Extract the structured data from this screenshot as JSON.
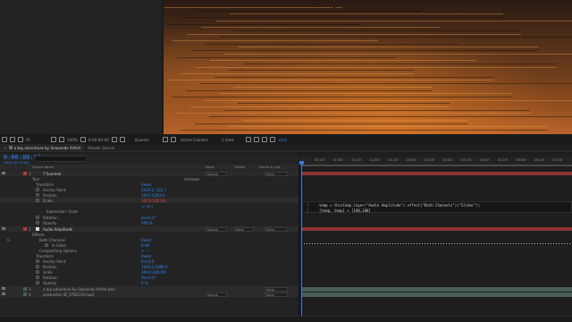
{
  "viewer_toolbar": {
    "snapping_label": "Fit",
    "zoom": "100%",
    "timecode": "0:00:00:00",
    "resolution": "Quarter",
    "camera": "Active Camera",
    "views": "1 View",
    "plus_value": "+0,0"
  },
  "tabs": [
    {
      "label": "a big adventure by Seasonds Artlist"
    },
    {
      "label": "Render Queue"
    }
  ],
  "timeline": {
    "timecode": "0:00:00:00",
    "fps": "00000 (29.97 fps)",
    "header": {
      "source_name": "Source Name",
      "mode": "Mode",
      "trkmat": "TrkMat",
      "parent": "Parent & Link"
    },
    "animate_label": "Animate:",
    "ruler_ticks": [
      "00:15f",
      "01:00f",
      "01:15f",
      "02:00f",
      "02:15f",
      "03:00f",
      "03:15f",
      "04:00f",
      "04:15f",
      "05:00f",
      "05:15f",
      "06:00f",
      "06:15f",
      "07:00f"
    ],
    "rows": [
      {
        "num": "1",
        "name": "T  Summer",
        "mode": "Normal",
        "parent": "None"
      },
      {
        "name": "Text"
      },
      {
        "name": "Transform",
        "value": "Reset"
      },
      {
        "name": "Anchor Point",
        "value": "1319.2,-122.7"
      },
      {
        "name": "Position",
        "value": "1917.0,854.0"
      },
      {
        "name": "Scale",
        "value": "106.0,106.0%"
      },
      {
        "name": "Expression: Scale"
      },
      {
        "name": "Rotation",
        "value": "0x+0.0°"
      },
      {
        "name": "Opacity",
        "value": "100 %"
      },
      {
        "num": "2",
        "name": "Audio Amplitude",
        "mode": "Normal",
        "trkmat": "None",
        "parent": "None"
      },
      {
        "name": "Effects"
      },
      {
        "name": "Both Channels",
        "value": "Reset"
      },
      {
        "name": "fx  Slider",
        "value": "0.00"
      },
      {
        "name": "Compositing Options",
        "value": "+ —"
      },
      {
        "name": "Transform",
        "value": "Reset"
      },
      {
        "name": "Anchor Point",
        "value": "0.0,0.0"
      },
      {
        "name": "Position",
        "value": "1920.0,1080.0"
      },
      {
        "name": "Scale",
        "value": "100.0,100.0%"
      },
      {
        "name": "Rotation",
        "value": "0x+0.0°"
      },
      {
        "name": "Opacity",
        "value": "0 %"
      },
      {
        "num": "3",
        "name": "a big adventure by Seasonds Artlist.wav",
        "parent": "None"
      },
      {
        "num": "4",
        "name": "production ID_3782219.mp4",
        "mode": "Normal",
        "parent": "None"
      }
    ],
    "expression": {
      "line1_num": "1",
      "line1": "temp = thisComp.layer(\"Audio Amplitude\").effect(\"Both Channels\")(\"Slider\");",
      "line2_num": "2",
      "line2": "[temp, temp] + [100,100]"
    }
  },
  "colors": {
    "accent_blue": "#2f8cff",
    "red_layer": "#b23b3b",
    "track_teal": "#4b5f5a",
    "playhead": "#3b7bdc"
  }
}
